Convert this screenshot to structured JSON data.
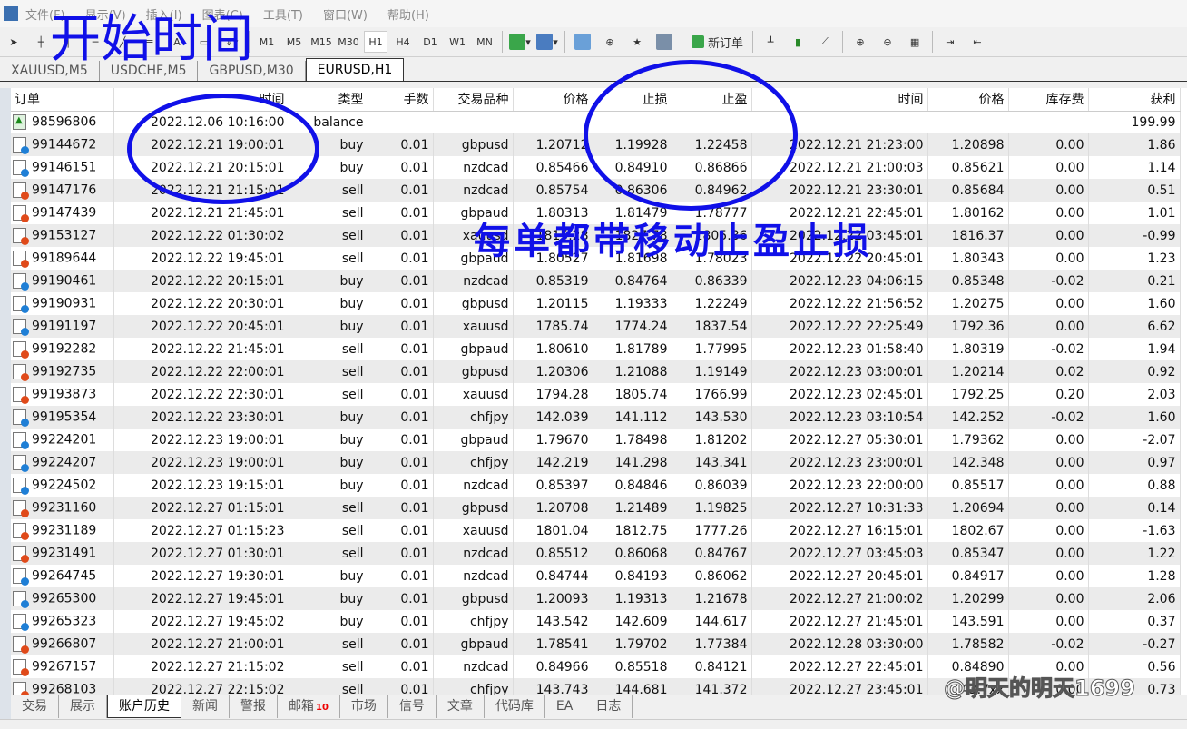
{
  "menu": [
    "文件(F)",
    "显示(V)",
    "插入(I)",
    "图表(C)",
    "工具(T)",
    "窗口(W)",
    "帮助(H)"
  ],
  "timeframes": [
    "M1",
    "M5",
    "M15",
    "M30",
    "H1",
    "H4",
    "D1",
    "W1",
    "MN"
  ],
  "active_timeframe": "H1",
  "toolbar": {
    "new_order": "新订单",
    "text_tool": "A"
  },
  "chart_tabs": [
    "XAUUSD,M5",
    "USDCHF,M5",
    "GBPUSD,M30",
    "EURUSD,H1"
  ],
  "active_chart_tab": "EURUSD,H1",
  "columns": [
    "订单",
    "时间",
    "类型",
    "手数",
    "交易品种",
    "价格",
    "止损",
    "止盈",
    "时间",
    "价格",
    "库存费",
    "获利"
  ],
  "balance_row": {
    "order": "98596806",
    "time": "2022.12.06 10:16:00",
    "type": "balance",
    "profit": "199.99"
  },
  "rows": [
    [
      "99144672",
      "2022.12.21 19:00:01",
      "buy",
      "0.01",
      "gbpusd",
      "1.20712",
      "1.19928",
      "1.22458",
      "2022.12.21 21:23:00",
      "1.20898",
      "0.00",
      "1.86"
    ],
    [
      "99146151",
      "2022.12.21 20:15:01",
      "buy",
      "0.01",
      "nzdcad",
      "0.85466",
      "0.84910",
      "0.86866",
      "2022.12.21 21:00:03",
      "0.85621",
      "0.00",
      "1.14"
    ],
    [
      "99147176",
      "2022.12.21 21:15:01",
      "sell",
      "0.01",
      "nzdcad",
      "0.85754",
      "0.86306",
      "0.84962",
      "2022.12.21 23:30:01",
      "0.85684",
      "0.00",
      "0.51"
    ],
    [
      "99147439",
      "2022.12.21 21:45:01",
      "sell",
      "0.01",
      "gbpaud",
      "1.80313",
      "1.81479",
      "1.78777",
      "2022.12.21 22:45:01",
      "1.80162",
      "0.00",
      "1.01"
    ],
    [
      "99153127",
      "2022.12.22 01:30:02",
      "sell",
      "0.01",
      "xauusd",
      "1815.28",
      "1827.78",
      "1805.86",
      "2022.12.22 03:45:01",
      "1816.37",
      "0.00",
      "-0.99"
    ],
    [
      "99189644",
      "2022.12.22 19:45:01",
      "sell",
      "0.01",
      "gbpaud",
      "1.80527",
      "1.81698",
      "1.78023",
      "2022.12.22 20:45:01",
      "1.80343",
      "0.00",
      "1.23"
    ],
    [
      "99190461",
      "2022.12.22 20:15:01",
      "buy",
      "0.01",
      "nzdcad",
      "0.85319",
      "0.84764",
      "0.86339",
      "2022.12.23 04:06:15",
      "0.85348",
      "-0.02",
      "0.21"
    ],
    [
      "99190931",
      "2022.12.22 20:30:01",
      "buy",
      "0.01",
      "gbpusd",
      "1.20115",
      "1.19333",
      "1.22249",
      "2022.12.22 21:56:52",
      "1.20275",
      "0.00",
      "1.60"
    ],
    [
      "99191197",
      "2022.12.22 20:45:01",
      "buy",
      "0.01",
      "xauusd",
      "1785.74",
      "1774.24",
      "1837.54",
      "2022.12.22 22:25:49",
      "1792.36",
      "0.00",
      "6.62"
    ],
    [
      "99192282",
      "2022.12.22 21:45:01",
      "sell",
      "0.01",
      "gbpaud",
      "1.80610",
      "1.81789",
      "1.77995",
      "2022.12.23 01:58:40",
      "1.80319",
      "-0.02",
      "1.94"
    ],
    [
      "99192735",
      "2022.12.22 22:00:01",
      "sell",
      "0.01",
      "gbpusd",
      "1.20306",
      "1.21088",
      "1.19149",
      "2022.12.23 03:00:01",
      "1.20214",
      "0.02",
      "0.92"
    ],
    [
      "99193873",
      "2022.12.22 22:30:01",
      "sell",
      "0.01",
      "xauusd",
      "1794.28",
      "1805.74",
      "1766.99",
      "2022.12.23 02:45:01",
      "1792.25",
      "0.20",
      "2.03"
    ],
    [
      "99195354",
      "2022.12.22 23:30:01",
      "buy",
      "0.01",
      "chfjpy",
      "142.039",
      "141.112",
      "143.530",
      "2022.12.23 03:10:54",
      "142.252",
      "-0.02",
      "1.60"
    ],
    [
      "99224201",
      "2022.12.23 19:00:01",
      "buy",
      "0.01",
      "gbpaud",
      "1.79670",
      "1.78498",
      "1.81202",
      "2022.12.27 05:30:01",
      "1.79362",
      "0.00",
      "-2.07"
    ],
    [
      "99224207",
      "2022.12.23 19:00:01",
      "buy",
      "0.01",
      "chfjpy",
      "142.219",
      "141.298",
      "143.341",
      "2022.12.23 23:00:01",
      "142.348",
      "0.00",
      "0.97"
    ],
    [
      "99224502",
      "2022.12.23 19:15:01",
      "buy",
      "0.01",
      "nzdcad",
      "0.85397",
      "0.84846",
      "0.86039",
      "2022.12.23 22:00:00",
      "0.85517",
      "0.00",
      "0.88"
    ],
    [
      "99231160",
      "2022.12.27 01:15:01",
      "sell",
      "0.01",
      "gbpusd",
      "1.20708",
      "1.21489",
      "1.19825",
      "2022.12.27 10:31:33",
      "1.20694",
      "0.00",
      "0.14"
    ],
    [
      "99231189",
      "2022.12.27 01:15:23",
      "sell",
      "0.01",
      "xauusd",
      "1801.04",
      "1812.75",
      "1777.26",
      "2022.12.27 16:15:01",
      "1802.67",
      "0.00",
      "-1.63"
    ],
    [
      "99231491",
      "2022.12.27 01:30:01",
      "sell",
      "0.01",
      "nzdcad",
      "0.85512",
      "0.86068",
      "0.84767",
      "2022.12.27 03:45:03",
      "0.85347",
      "0.00",
      "1.22"
    ],
    [
      "99264745",
      "2022.12.27 19:30:01",
      "buy",
      "0.01",
      "nzdcad",
      "0.84744",
      "0.84193",
      "0.86062",
      "2022.12.27 20:45:01",
      "0.84917",
      "0.00",
      "1.28"
    ],
    [
      "99265300",
      "2022.12.27 19:45:01",
      "buy",
      "0.01",
      "gbpusd",
      "1.20093",
      "1.19313",
      "1.21678",
      "2022.12.27 21:00:02",
      "1.20299",
      "0.00",
      "2.06"
    ],
    [
      "99265323",
      "2022.12.27 19:45:02",
      "buy",
      "0.01",
      "chfjpy",
      "143.542",
      "142.609",
      "144.617",
      "2022.12.27 21:45:01",
      "143.591",
      "0.00",
      "0.37"
    ],
    [
      "99266807",
      "2022.12.27 21:00:01",
      "sell",
      "0.01",
      "gbpaud",
      "1.78541",
      "1.79702",
      "1.77384",
      "2022.12.28 03:30:00",
      "1.78582",
      "-0.02",
      "-0.27"
    ],
    [
      "99267157",
      "2022.12.27 21:15:02",
      "sell",
      "0.01",
      "nzdcad",
      "0.84966",
      "0.85518",
      "0.84121",
      "2022.12.27 22:45:01",
      "0.84890",
      "0.00",
      "0.56"
    ],
    [
      "99268103",
      "2022.12.27 22:15:02",
      "sell",
      "0.01",
      "chfjpy",
      "143.743",
      "144.681",
      "141.372",
      "2022.12.27 23:45:01",
      "143.7xx",
      "0.00",
      "0.73"
    ]
  ],
  "bottom_tabs": [
    "交易",
    "展示",
    "账户历史",
    "新闻",
    "警报",
    "邮箱",
    "市场",
    "信号",
    "文章",
    "代码库",
    "EA",
    "日志"
  ],
  "active_bottom_tab": "账户历史",
  "mail_badge": "10",
  "annotations": {
    "start_time": "开始时间",
    "trailing_note": "每单都带移动止盈止损"
  },
  "watermark": "@明天的明天1699",
  "colors": {
    "annotation": "#1010e8",
    "buy_icon": "#1f7fd6",
    "sell_icon": "#e04a1a"
  }
}
